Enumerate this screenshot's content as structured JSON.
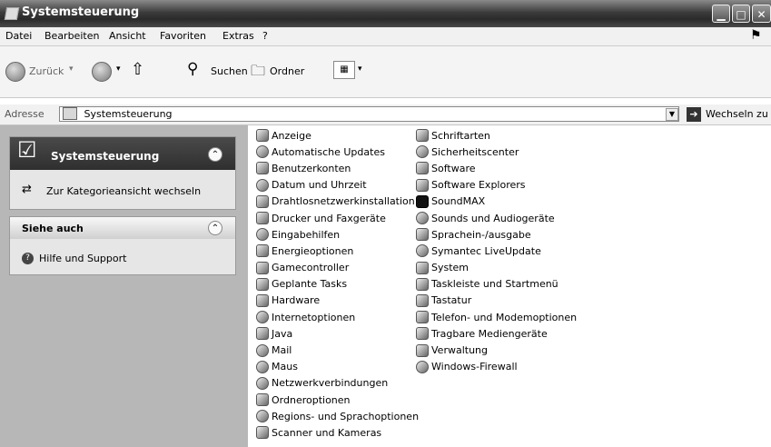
{
  "window": {
    "title": "Systemsteuerung"
  },
  "menu": [
    {
      "label": "Datei"
    },
    {
      "label": "Bearbeiten"
    },
    {
      "label": "Ansicht"
    },
    {
      "label": "Favoriten"
    },
    {
      "label": "Extras"
    },
    {
      "label": "?"
    }
  ],
  "toolbar": {
    "back": "Zurück",
    "search": "Suchen",
    "folders": "Ordner"
  },
  "address": {
    "label": "Adresse",
    "value": "Systemsteuerung",
    "go": "Wechseln zu"
  },
  "sidebar": {
    "panel_title": "Systemsteuerung",
    "switch_link": "Zur Kategorieansicht wechseln",
    "see_also_title": "Siehe auch",
    "help_link": "Hilfe und Support"
  },
  "items_col1": [
    "Anzeige",
    "Automatische Updates",
    "Benutzerkonten",
    "Datum und Uhrzeit",
    "Drahtlosnetzwerkinstallation",
    "Drucker und Faxgeräte",
    "Eingabehilfen",
    "Energieoptionen",
    "Gamecontroller",
    "Geplante Tasks",
    "Hardware",
    "Internetoptionen",
    "Java",
    "Mail",
    "Maus",
    "Netzwerkverbindungen",
    "Ordneroptionen",
    "Regions- und Sprachoptionen",
    "Scanner und Kameras"
  ],
  "items_col2": [
    "Schriftarten",
    "Sicherheitscenter",
    "Software",
    "Software Explorers",
    "SoundMAX",
    "Sounds und Audiogeräte",
    "Sprachein-/ausgabe",
    "Symantec LiveUpdate",
    "System",
    "Taskleiste und Startmenü",
    "Tastatur",
    "Telefon- und Modemoptionen",
    "Tragbare Mediengeräte",
    "Verwaltung",
    "Windows-Firewall"
  ]
}
